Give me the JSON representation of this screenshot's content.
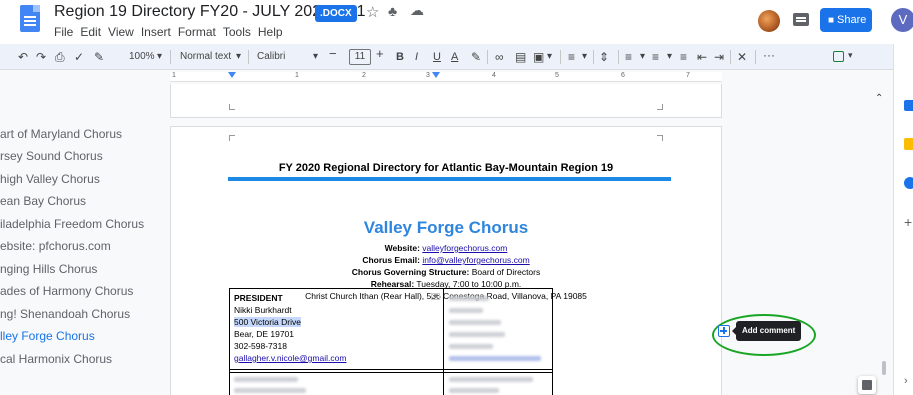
{
  "header": {
    "doc_title": "Region 19 Directory FY20 - JULY 2020 rev1",
    "format_badge": ".DOCX",
    "star_icon": "☆",
    "move_icon": "♣",
    "cloud_icon": "☁",
    "menus": [
      "File",
      "Edit",
      "View",
      "Insert",
      "Format",
      "Tools",
      "Help"
    ],
    "share_label": "Share",
    "user_initial": "V"
  },
  "toolbar": {
    "zoom": "100%",
    "style": "Normal text",
    "font": "Calibri",
    "font_size": "11",
    "more": "···"
  },
  "ruler": {
    "ticks": [
      "1",
      "1",
      "2",
      "3",
      "4",
      "5",
      "6",
      "7"
    ]
  },
  "outline": {
    "items": [
      "art of Maryland Chorus",
      "rsey Sound Chorus",
      "high Valley Chorus",
      "ean Bay Chorus",
      "iladelphia Freedom Chorus",
      "ebsite: pfchorus.com",
      "nging Hills Chorus",
      "ades of Harmony Chorus",
      "ng! Shenandoah Chorus",
      "lley Forge Chorus",
      "cal Harmonix Chorus"
    ],
    "active_index": 9
  },
  "document": {
    "heading": "FY 2020 Regional Directory for Atlantic Bay-Mountain Region 19",
    "chorus_name": "Valley Forge Chorus",
    "website_label": "Website:",
    "website": "valleyforgechorus.com",
    "email_label": "Chorus Email:",
    "email": "info@valleyforgechorus.com",
    "structure_label": "Chorus Governing Structure:",
    "structure": "Board of Directors",
    "rehearsal_label": "Rehearsal:",
    "rehearsal": "Tuesday, 7:00 to 10:00 p.m.",
    "location": "Christ Church Ithan (Rear Hall), 536 Conestoga Road, Villanova, PA 19085",
    "table": {
      "role": "PRESIDENT",
      "name": "Nikki Burkhardt",
      "street": "500 Victoria Drive",
      "city": "Bear, DE 19701",
      "phone": "302-598-7318",
      "email": "gallagher.v.nicole@gmail.com"
    }
  },
  "comment": {
    "tooltip": "Add comment"
  },
  "colors": {
    "accent": "#1a73e8",
    "chorus_blue": "#2e86de",
    "highlight_ring": "#1aa526"
  }
}
